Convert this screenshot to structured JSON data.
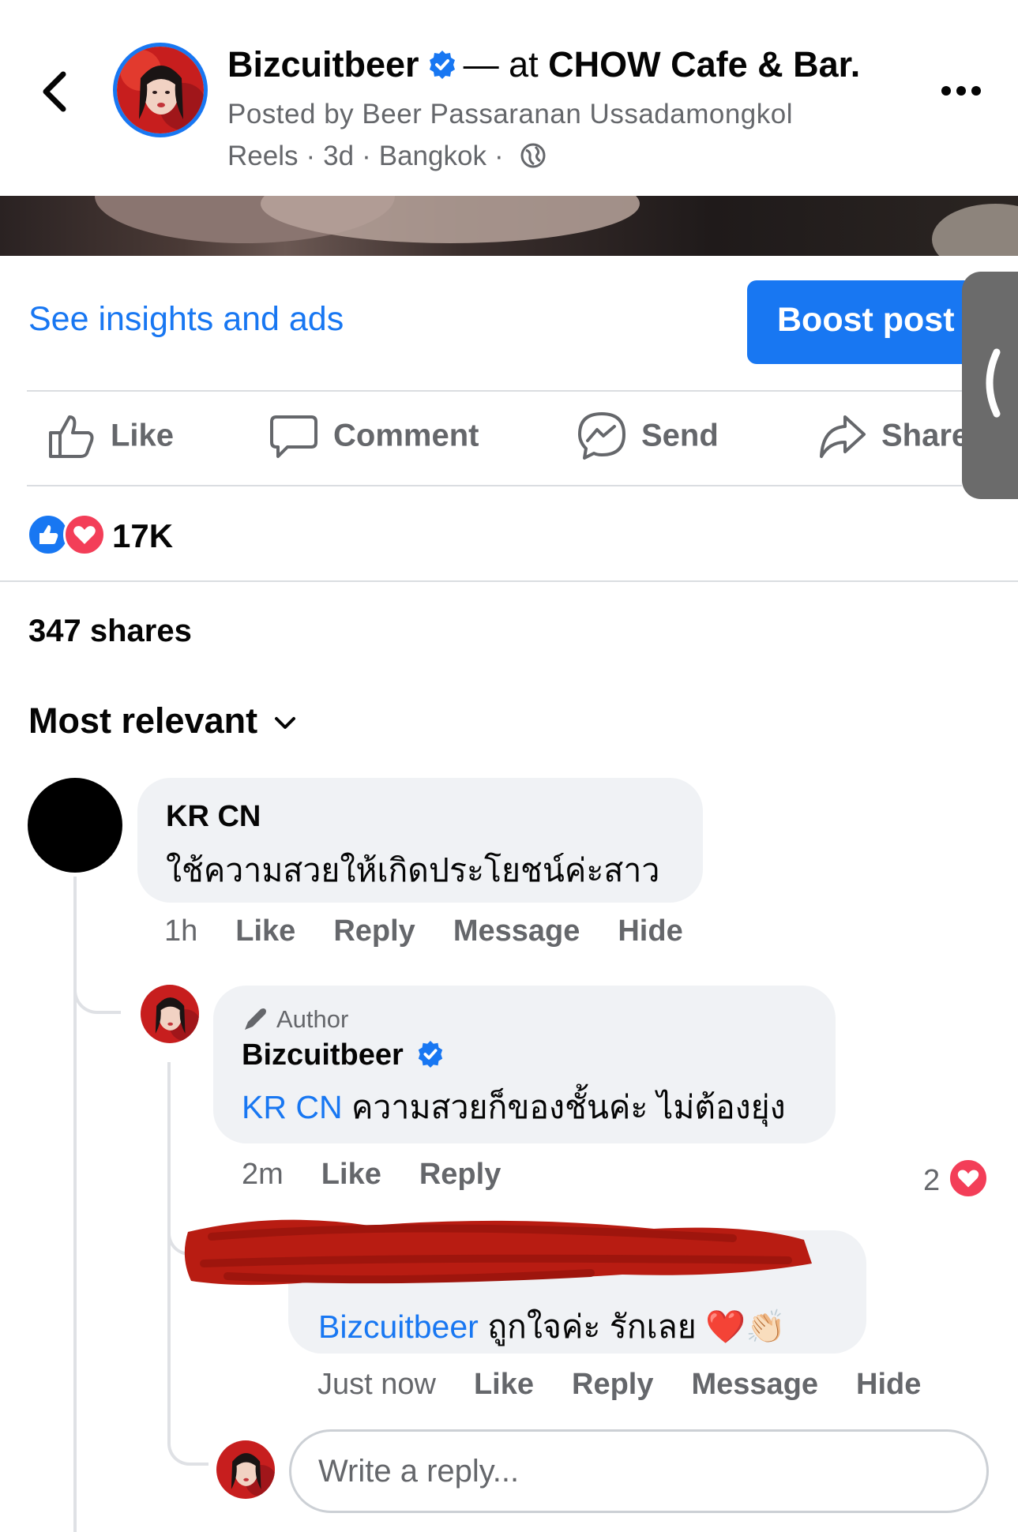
{
  "header": {
    "page_name": "Bizcuitbeer",
    "location_prefix": "— at",
    "location": "CHOW Cafe & Bar.",
    "posted_by": "Posted by Beer Passaranan Ussadamongkol",
    "type": "Reels",
    "age": "3d",
    "city": "Bangkok",
    "separator": "·"
  },
  "insights": {
    "link_label": "See insights and ads",
    "boost_label": "Boost post"
  },
  "actions": [
    {
      "label": "Like",
      "icon": "thumbs-up-icon"
    },
    {
      "label": "Comment",
      "icon": "comment-icon"
    },
    {
      "label": "Send",
      "icon": "messenger-icon"
    },
    {
      "label": "Share",
      "icon": "share-arrow-icon"
    }
  ],
  "stats": {
    "reaction_count": "17K",
    "shares": "347 shares"
  },
  "sort": {
    "label": "Most relevant"
  },
  "comments": [
    {
      "name": "KR CN",
      "text": "ใช้ความสวยให้เกิดประโยชน์ค่ะสาว",
      "time": "1h",
      "actions": [
        "Like",
        "Reply",
        "Message",
        "Hide"
      ]
    },
    {
      "badge": "Author",
      "name": "Bizcuitbeer",
      "mention": "KR CN",
      "text": "ความสวยก็ของชั้นค่ะ ไม่ต้องยุ่ง",
      "time": "2m",
      "actions": [
        "Like",
        "Reply"
      ],
      "reaction_count": "2"
    },
    {
      "mention": "Bizcuitbeer",
      "text": "ถูกใจค่ะ รักเลย ❤️👏🏻",
      "time": "Just now",
      "actions": [
        "Like",
        "Reply",
        "Message",
        "Hide"
      ]
    }
  ],
  "reply_box": {
    "placeholder": "Write a reply..."
  },
  "colors": {
    "accent": "#1877f2",
    "secondary_text": "#65676b",
    "bubble": "#f0f2f5",
    "love": "#f33e58",
    "redaction": "#b81c12"
  }
}
